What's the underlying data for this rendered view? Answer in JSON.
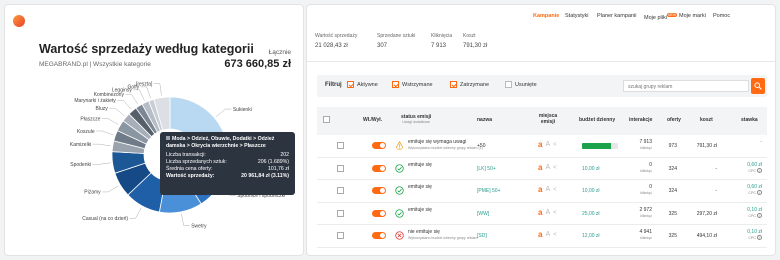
{
  "left": {
    "title": "Wartość sprzedaży według kategorii",
    "subtitle": "MEGABRAND.pl | Wszystkie kategorie",
    "total_label": "Łącznie",
    "total_value": "673 660,85 zł",
    "slice_labels": [
      "[reszta]",
      "Golfy",
      "Legginsy",
      "Kombinezony",
      "Marynarki i żakiety",
      "Bluzy",
      "Płaszcze",
      "Koszule",
      "Kamizelki",
      "Spodenki",
      "Piżamy",
      "Casual (na co dzień)",
      "Swetry",
      "Spódnice i spódniczki",
      "Sukienki"
    ],
    "tooltip": {
      "path": "Moda > Odzież, Obuwie, Dodatki > Odzież damska > Okrycia wierzchnie > Płaszcze",
      "rows": [
        {
          "label": "Liczba transakcji:",
          "value": "202"
        },
        {
          "label": "Liczba sprzedanych sztuk:",
          "value": "206 (1.689%)"
        },
        {
          "label": "Średnia cena oferty:",
          "value": "101,76 zł"
        }
      ],
      "sales_label": "Wartość sprzedaży:",
      "sales_value": "20 961,84 zł (3.11%)"
    }
  },
  "chart_data": {
    "type": "pie",
    "categories": [
      "Sukienki",
      "Spódnice i spódniczki",
      "Swetry",
      "Casual (na co dzień)",
      "Piżamy",
      "Spodenki",
      "Kamizelki",
      "Koszule",
      "Płaszcze",
      "Bluzy",
      "Marynarki i żakiety",
      "Kombinezony",
      "Legginsy",
      "Golfy",
      "[reszta]"
    ],
    "values": [
      28,
      13,
      12,
      10,
      7,
      6,
      3,
      3,
      3.11,
      2.5,
      2.5,
      2,
      2,
      1.5,
      4.5
    ],
    "colors": [
      "#b9d8f1",
      "#2c73c4",
      "#4a90d9",
      "#1f5fa8",
      "#164a87",
      "#1d5896",
      "#9aa3ad",
      "#6f7b88",
      "#8b96a3",
      "#a6afb9",
      "#56606b",
      "#7d8793",
      "#b6bdc6",
      "#c9ced5",
      "#dcdfe3"
    ]
  },
  "right": {
    "nav": [
      {
        "label": "Kampanie",
        "active": true
      },
      {
        "label": "Statystyki",
        "active": false
      },
      {
        "label": "Planer kampanii",
        "active": false
      },
      {
        "label": "Moje pliki",
        "active": false,
        "badge": "NEW"
      },
      {
        "label": "Moje marki",
        "active": false
      },
      {
        "label": "Pomoc",
        "active": false
      }
    ],
    "stats": [
      {
        "label": "Wartość sprzedaży",
        "value": "21 028,43 zł"
      },
      {
        "label": "Sprzedane sztuki",
        "value": "307"
      },
      {
        "label": "Kliknięcia",
        "value": "7 913"
      },
      {
        "label": "Koszt",
        "value": "791,30 zł"
      }
    ],
    "filter": {
      "label": "Filtruj",
      "options": [
        {
          "label": "Aktywne",
          "checked": true
        },
        {
          "label": "Wstrzymane",
          "checked": true
        },
        {
          "label": "Zatrzymane",
          "checked": true
        },
        {
          "label": "Usunięte",
          "checked": false
        }
      ],
      "search_placeholder": "szukaj grupy reklam"
    },
    "columns": {
      "onoff": "Wł./Wył.",
      "status": "status emisji",
      "status_sub": "Uwagi dodatkowe",
      "name": "nazwa",
      "places": "miejsca emisji",
      "budget": "budżet dzienny",
      "interactions": "interakcje",
      "offers": "oferty",
      "cost": "koszt",
      "rate": "stawka"
    },
    "rows": [
      {
        "status": "emituje się wymaga uwagi",
        "status_sub": "Wykorzystano budżet dzienny grupy reklam (1)",
        "status_kind": "warn",
        "name": "+50",
        "name_plain": true,
        "budget_fill": 0.8,
        "budget_text": "",
        "interactions": "7 913",
        "interactions_sub": "kliknięć",
        "offers": "973",
        "cost": "791,30 zł",
        "rate": "-",
        "rate_sub": ""
      },
      {
        "status": "emituje się",
        "status_sub": "",
        "status_kind": "ok",
        "name": "[LK] 50+",
        "name_plain": false,
        "budget_fill": 0,
        "budget_text": "10,00 zł",
        "interactions": "0",
        "interactions_sub": "kliknięć",
        "offers": "324",
        "cost": "-",
        "rate": "0,60 zł",
        "rate_sub": "CPC"
      },
      {
        "status": "emituje się",
        "status_sub": "",
        "status_kind": "ok",
        "name": "[PME] 50+",
        "name_plain": false,
        "budget_fill": 0,
        "budget_text": "10,00 zł",
        "interactions": "0",
        "interactions_sub": "kliknięć",
        "offers": "324",
        "cost": "-",
        "rate": "0,60 zł",
        "rate_sub": "CPC"
      },
      {
        "status": "emituje się",
        "status_sub": "",
        "status_kind": "ok",
        "name": "[WW]",
        "name_plain": false,
        "budget_fill": 0,
        "budget_text": "25,00 zł",
        "interactions": "2 972",
        "interactions_sub": "kliknięć",
        "offers": "325",
        "cost": "297,20 zł",
        "rate": "0,10 zł",
        "rate_sub": "CPC"
      },
      {
        "status": "nie emituje się",
        "status_sub": "Wykorzystano budżet dzienny grupy reklam",
        "status_kind": "err",
        "name": "[SD]",
        "name_plain": false,
        "budget_fill": 0,
        "budget_text": "12,00 zł",
        "interactions": "4 941",
        "interactions_sub": "kliknięć",
        "offers": "325",
        "cost": "494,10 zł",
        "rate": "0,10 zł",
        "rate_sub": "CPC"
      }
    ]
  }
}
